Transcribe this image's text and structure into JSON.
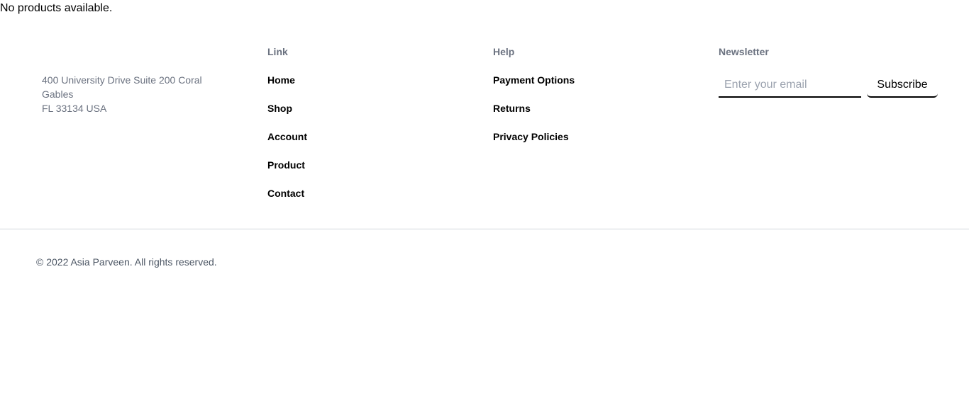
{
  "main": {
    "empty_message": "No products available."
  },
  "footer": {
    "address": {
      "line1": "400 University Drive Suite 200 Coral Gables",
      "line2": "FL 33134 USA"
    },
    "links": {
      "title": "Link",
      "items": [
        "Home",
        "Shop",
        "Account",
        "Product",
        "Contact"
      ]
    },
    "help": {
      "title": "Help",
      "items": [
        "Payment Options",
        "Returns",
        "Privacy Policies"
      ]
    },
    "newsletter": {
      "title": "Newsletter",
      "email_placeholder": "Enter your email",
      "email_value": "",
      "subscribe_label": "Subscribe"
    },
    "copyright": "© 2022 Asia Parveen. All rights reserved."
  }
}
